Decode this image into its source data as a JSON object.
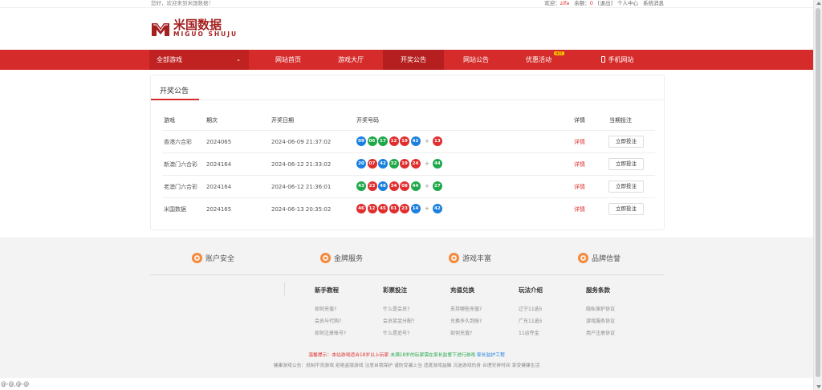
{
  "topbar": {
    "greeting": "您好，欢迎来到米国数据！",
    "welcome": "欢迎：",
    "username": "zifa",
    "messages_label": "余额：",
    "messages_count": "0",
    "logout": "[退出]",
    "user_center": "个人中心",
    "system_message": "系统消息"
  },
  "logo": {
    "title": "米国数据",
    "subtitle": "MIGUO SHUJU"
  },
  "nav": {
    "all_games": "全部游戏",
    "items": [
      {
        "label": "网站首页"
      },
      {
        "label": "游戏大厅"
      },
      {
        "label": "开奖公告"
      },
      {
        "label": "网站公告"
      },
      {
        "label": "优惠活动",
        "badge": "HOT"
      },
      {
        "label": "手机网站"
      }
    ]
  },
  "panel": {
    "title": "开奖公告",
    "columns": [
      "游戏",
      "期次",
      "开奖日期",
      "开奖号码",
      "详情",
      "当期投注"
    ],
    "detail_label": "详情",
    "bet_label": "立即投注",
    "rows": [
      {
        "game": "香港六合彩",
        "issue": "2024065",
        "date": "2024-06-09 21:37:02",
        "balls": [
          {
            "n": "09",
            "c": "blue"
          },
          {
            "n": "06",
            "c": "green"
          },
          {
            "n": "17",
            "c": "green"
          },
          {
            "n": "12",
            "c": "red"
          },
          {
            "n": "19",
            "c": "red"
          },
          {
            "n": "42",
            "c": "blue"
          }
        ],
        "special": {
          "n": "13",
          "c": "red"
        }
      },
      {
        "game": "新澳门六合彩",
        "issue": "2024164",
        "date": "2024-06-12 21:33:02",
        "balls": [
          {
            "n": "20",
            "c": "blue"
          },
          {
            "n": "07",
            "c": "red"
          },
          {
            "n": "42",
            "c": "blue"
          },
          {
            "n": "32",
            "c": "green"
          },
          {
            "n": "19",
            "c": "red"
          },
          {
            "n": "24",
            "c": "red"
          }
        ],
        "special": {
          "n": "44",
          "c": "green"
        }
      },
      {
        "game": "老澳门六合彩",
        "issue": "2024164",
        "date": "2024-06-12 21:36:01",
        "balls": [
          {
            "n": "43",
            "c": "green"
          },
          {
            "n": "23",
            "c": "red"
          },
          {
            "n": "48",
            "c": "blue"
          },
          {
            "n": "34",
            "c": "red"
          },
          {
            "n": "08",
            "c": "red"
          },
          {
            "n": "44",
            "c": "green"
          }
        ],
        "special": {
          "n": "27",
          "c": "green"
        }
      },
      {
        "game": "米国数据",
        "issue": "2024165",
        "date": "2024-06-13 20:35:02",
        "balls": [
          {
            "n": "46",
            "c": "red"
          },
          {
            "n": "12",
            "c": "red"
          },
          {
            "n": "45",
            "c": "red"
          },
          {
            "n": "01",
            "c": "red"
          },
          {
            "n": "23",
            "c": "red"
          },
          {
            "n": "14",
            "c": "blue"
          }
        ],
        "special": {
          "n": "42",
          "c": "blue"
        }
      }
    ]
  },
  "footer": {
    "features": [
      "账户安全",
      "金牌服务",
      "游戏丰富",
      "品牌信誉"
    ],
    "columns": [
      {
        "title": "新手教程",
        "links": [
          "如何充值?",
          "会员与代购?",
          "如何注册账号?"
        ]
      },
      {
        "title": "彩票投注",
        "links": [
          "什么是会员?",
          "会员奖金分配?",
          "什么是追号?"
        ]
      },
      {
        "title": "充值兑换",
        "links": [
          "支持哪些充值?",
          "兑换多久到账?",
          "如何充值?"
        ]
      },
      {
        "title": "玩法介绍",
        "links": [
          "辽宁11选5",
          "广东11选5",
          "11运夺金"
        ]
      },
      {
        "title": "服务条款",
        "links": [
          "隐私保护协议",
          "游戏服务协议",
          "用户注册协议"
        ]
      }
    ],
    "notice_a": "温馨提示：本站游戏适合18岁以上玩家",
    "notice_b": "未满18岁的玩家需在家长监督下进行游戏",
    "notice_c": "家长监护工程",
    "notice2": "健康游戏公告：抵制不良游戏 拒绝盗版游戏 注意自我保护 谨防受骗上当 适度游戏益脑 沉迷游戏伤身 合理安排时间 享受健康生活"
  },
  "status": {
    "text": "@-@,@-@"
  }
}
